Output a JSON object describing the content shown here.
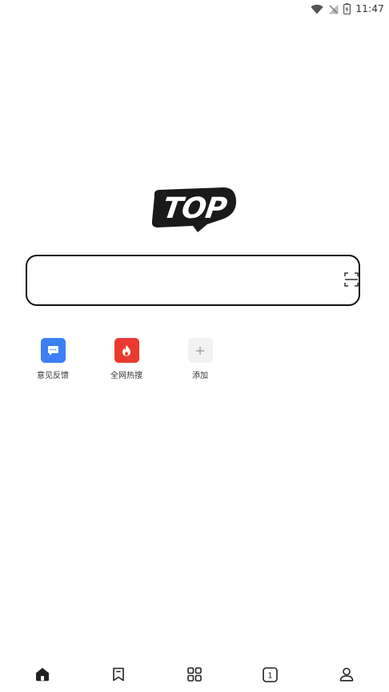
{
  "status_bar": {
    "time": "11:47",
    "icons": [
      "wifi-icon",
      "no-signal-icon",
      "battery-charging-icon"
    ]
  },
  "logo": {
    "text": "TOP"
  },
  "search": {
    "placeholder": "",
    "value": ""
  },
  "shortcuts": [
    {
      "label": "意见反馈",
      "icon": "chat-bubble-icon",
      "color": "#3b7ff5"
    },
    {
      "label": "全网热搜",
      "icon": "flame-icon",
      "color": "#ea3a2f"
    },
    {
      "label": "添加",
      "icon": "plus-icon",
      "color": "#f2f2f2"
    }
  ],
  "bottom_nav": {
    "items": [
      "home-icon",
      "bookmark-icon",
      "apps-grid-icon",
      "tabs-icon",
      "profile-icon"
    ],
    "tab_count": "1"
  }
}
